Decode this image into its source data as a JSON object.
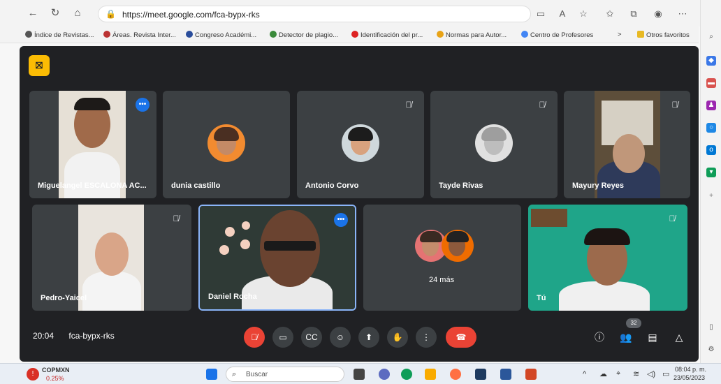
{
  "browser": {
    "url": "https://meet.google.com/fca-bypx-rks",
    "bookmarks": [
      {
        "label": "Índice de Revistas...",
        "color": "#555"
      },
      {
        "label": "Áreas. Revista Inter...",
        "color": "#b33"
      },
      {
        "label": "Congreso Académi...",
        "color": "#2a4d9b"
      },
      {
        "label": "Detector de plagio...",
        "color": "#3a8a3a"
      },
      {
        "label": "Identificación del pr...",
        "color": "#d22"
      },
      {
        "label": "Normas para Autor...",
        "color": "#e8a317"
      },
      {
        "label": "Centro de Profesores",
        "color": "#4285f4"
      },
      {
        "label": "Otros favoritos",
        "color": "#e8b923"
      }
    ],
    "bookmark_more": ">"
  },
  "meet": {
    "warning_icon": "no-camera-icon",
    "participants": [
      {
        "name": "Miguelangel ESCALONA AC...",
        "state": "speaking",
        "kind": "video"
      },
      {
        "name": "dunia castillo",
        "state": "none",
        "kind": "avatar"
      },
      {
        "name": "Antonio Corvo",
        "state": "muted",
        "kind": "avatar"
      },
      {
        "name": "Tayde Rivas",
        "state": "muted",
        "kind": "avatar"
      },
      {
        "name": "Mayury Reyes",
        "state": "muted",
        "kind": "video"
      },
      {
        "name": "Pedro-Yaicel",
        "state": "muted",
        "kind": "video"
      },
      {
        "name": "Daniel Rocha",
        "state": "pinned",
        "kind": "video"
      },
      {
        "name": "",
        "state": "none",
        "kind": "more"
      },
      {
        "name": "Tú",
        "state": "muted",
        "kind": "video"
      }
    ],
    "more_count": "24 más",
    "time": "20:04",
    "meeting_code": "fca-bypx-rks",
    "participants_badge": "32",
    "controls": [
      "mic-off-icon",
      "camera-icon",
      "captions-icon",
      "emoji-icon",
      "present-icon",
      "hand-icon",
      "more-vert-icon",
      "end-call-icon"
    ],
    "right_controls": [
      "info-icon",
      "people-icon",
      "chat-icon",
      "activities-icon"
    ]
  },
  "taskbar": {
    "weather": "COPMXN",
    "weather_sub": "0.25%",
    "search": "Buscar",
    "time": "08:04 p. m.",
    "date": "23/05/2023"
  }
}
